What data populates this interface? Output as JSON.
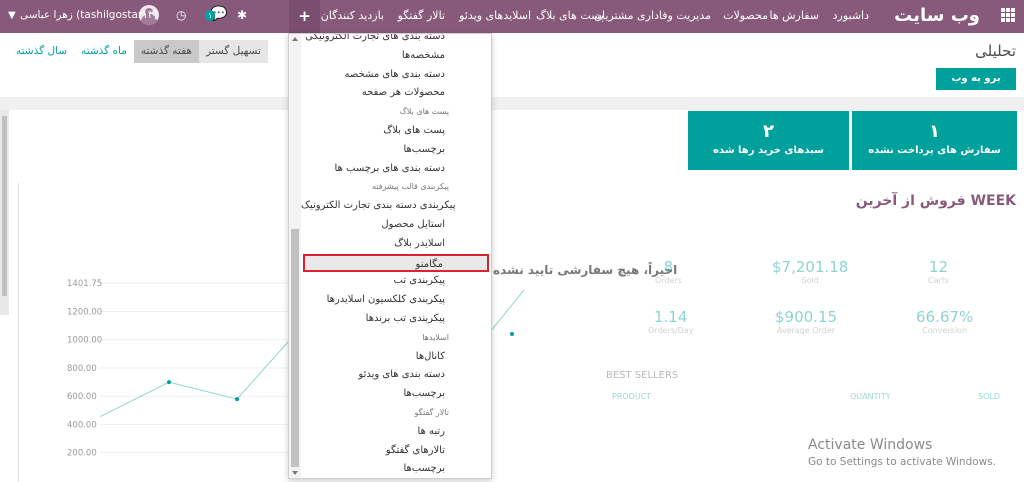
{
  "topbar": {
    "brand": "وب سایت",
    "menu": [
      "داشبورد",
      "سفارش ها",
      "محصولات",
      "مدیریت وفاداری مشتریان",
      "پست های بلاگ",
      "اسلایدهای ویدئو",
      "تالار گفتگو",
      "بازدید کنندگان"
    ],
    "plus": "+",
    "badge": "۱",
    "user": "زهرا عباسی (tashilgostar۱۳)",
    "bg_color": "#875a7b"
  },
  "filters": {
    "items": [
      "تسهیل گستر",
      "هفته گذشته",
      "ماه گذشته",
      "سال گذشته"
    ]
  },
  "page": {
    "title": "تحلیلی",
    "go_site": "برو به وب سایت"
  },
  "kpis": [
    {
      "value": "۱",
      "label": "سفارش های پرداخت نشده"
    },
    {
      "value": "۲",
      "label": "سبدهای خرید رها شده"
    }
  ],
  "sales": {
    "title": "فروش از آخرین WEEK",
    "no_orders": "اخیراً، هیچ سفارشی تایید نشده",
    "stats": [
      {
        "value": "8",
        "label": "Orders"
      },
      {
        "value": "$7,201.18",
        "label": "Sold"
      },
      {
        "value": "12",
        "label": "Carts"
      },
      {
        "value": "1.14",
        "label": "Orders/Day"
      },
      {
        "value": "$900.15",
        "label": "Average Order"
      },
      {
        "value": "66.67%",
        "label": "Conversion"
      }
    ],
    "best_sellers": "BEST SELLERS",
    "cols": [
      "PRODUCT",
      "QUANTITY",
      "SOLD"
    ]
  },
  "chart_data": {
    "type": "line",
    "y_ticks": [
      "1401.75",
      "1200.00",
      "1000.00",
      "800.00",
      "600.00",
      "400.00",
      "200.00"
    ],
    "values": [
      455,
      700,
      580,
      1000
    ],
    "ylim": [
      0,
      1401.75
    ]
  },
  "dropdown": {
    "items": [
      {
        "label": "دسته بندی های تجارت الکترونیکی",
        "type": "item"
      },
      {
        "label": "مشخصه‌ها",
        "type": "item"
      },
      {
        "label": "دسته بندی های مشخصه",
        "type": "item"
      },
      {
        "label": "محصولات هر صفحه",
        "type": "item"
      },
      {
        "label": "پست های بلاگ",
        "type": "header"
      },
      {
        "label": "پست های بلاگ",
        "type": "item"
      },
      {
        "label": "برچسب‌ها",
        "type": "item"
      },
      {
        "label": "دسته بندی های برچسب ها",
        "type": "item"
      },
      {
        "label": "پیکربندی قالب پیشرفته",
        "type": "header"
      },
      {
        "label": "پیکربندی دسته بندی تجارت الکترونیک",
        "type": "item"
      },
      {
        "label": "استایل محصول",
        "type": "item"
      },
      {
        "label": "اسلایدر بلاگ",
        "type": "item"
      },
      {
        "label": "مگامنو",
        "type": "selected"
      },
      {
        "label": "پیکربندی تب",
        "type": "item"
      },
      {
        "label": "پیکربندی کلکسیون اسلایدرها",
        "type": "item"
      },
      {
        "label": "پیکربندی تب برندها",
        "type": "item"
      },
      {
        "label": "اسلایدها",
        "type": "header"
      },
      {
        "label": "کانال‌ها",
        "type": "item"
      },
      {
        "label": "دسته بندی های ویدئو",
        "type": "item"
      },
      {
        "label": "برچسب‌ها",
        "type": "item"
      },
      {
        "label": "تالار گفتگو",
        "type": "header"
      },
      {
        "label": "رتبه ها",
        "type": "item"
      },
      {
        "label": "تالارهای گفتگو",
        "type": "item"
      },
      {
        "label": "برچسب‌ها",
        "type": "item"
      }
    ]
  },
  "watermark": {
    "line1": "Activate Windows",
    "line2": "Go to Settings to activate Windows."
  }
}
